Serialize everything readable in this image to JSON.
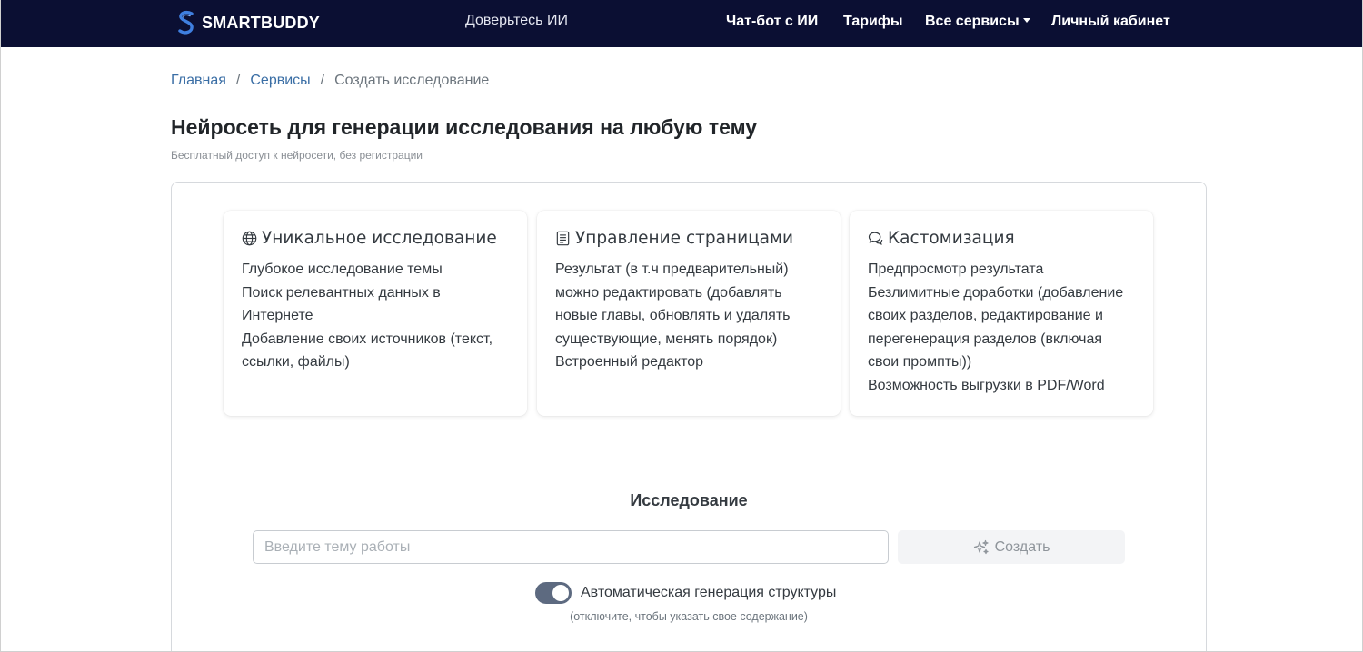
{
  "navbar": {
    "brand": "SMARTBUDDY",
    "tagline": "Доверьтесь ИИ",
    "links": {
      "chat": "Чат-бот с ИИ",
      "tariffs": "Тарифы",
      "services": "Все сервисы",
      "cabinet": "Личный кабинет"
    }
  },
  "breadcrumb": {
    "home": "Главная",
    "separator": "/",
    "services": "Сервисы",
    "current": "Создать исследование"
  },
  "page": {
    "title": "Нейросеть для генерации исследования на любую тему",
    "subtitle": "Бесплатный доступ к нейросети, без регистрации"
  },
  "features": [
    {
      "icon": "globe-icon",
      "title": "Уникальное исследование",
      "lines": [
        "Глубокое исследование темы",
        "Поиск релевантных данных в",
        "Интернете",
        "Добавление своих источников (текст,",
        "ссылки, файлы)"
      ]
    },
    {
      "icon": "document-icon",
      "title": "Управление страницами",
      "lines": [
        "Результат (в т.ч предварительный)",
        "можно редактировать (добавлять",
        "новые главы, обновлять и удалять",
        "существующие, менять порядок)",
        "Встроенный редактор"
      ]
    },
    {
      "icon": "chat-bubbles-icon",
      "title": "Кастомизация",
      "lines": [
        "Предпросмотр результата",
        "Безлимитные доработки (добавление",
        "своих разделов, редактирование и",
        "перегенерация разделов (включая",
        "свои промпты))",
        "Возможность выгрузки в PDF/Word"
      ]
    }
  ],
  "form": {
    "section_title": "Исследование",
    "input_placeholder": "Введите тему работы",
    "input_value": "",
    "create_label": "Создать",
    "toggle_label": "Автоматическая генерация структуры",
    "toggle_on": true,
    "toggle_hint": "(отключите, чтобы указать свое содержание)"
  },
  "colors": {
    "navbar_bg": "#0b0f33",
    "link": "#3a6ea5",
    "toggle": "#5d6a80"
  }
}
